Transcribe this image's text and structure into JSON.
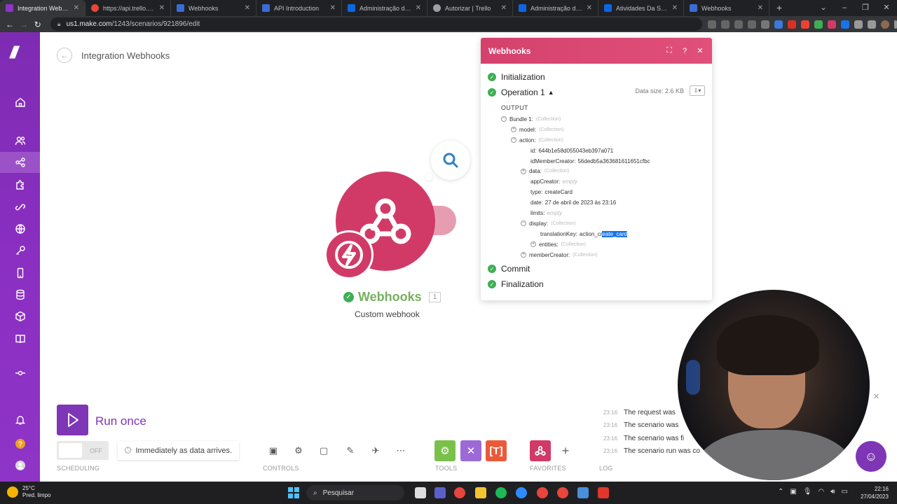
{
  "browser": {
    "tabs": [
      {
        "title": "Integration Webhooks",
        "active": true,
        "color": "#8e34c6"
      },
      {
        "title": "https://api.trello.com/",
        "active": false,
        "color": "#e8453c"
      },
      {
        "title": "Webhooks",
        "active": false,
        "color": "#3b6bd6"
      },
      {
        "title": "API Introduction",
        "active": false,
        "color": "#3b6bd6"
      },
      {
        "title": "Administração de pow",
        "active": false,
        "color": "#0c66e4"
      },
      {
        "title": "Autorizar | Trello",
        "active": false,
        "color": "#9aa0a6"
      },
      {
        "title": "Administração de pow",
        "active": false,
        "color": "#0c66e4"
      },
      {
        "title": "Atividades Da Semana",
        "active": false,
        "color": "#0c66e4"
      },
      {
        "title": "Webhooks",
        "active": false,
        "color": "#3b6bd6"
      }
    ],
    "url_host": "us1.make.com",
    "url_path": "/1243/scenarios/921896/edit"
  },
  "scenario": {
    "title": "Integration Webhooks"
  },
  "module": {
    "name": "Webhooks",
    "count": "1",
    "subtitle": "Custom webhook"
  },
  "panel": {
    "title": "Webhooks",
    "phases": {
      "initialization": "Initialization",
      "operation": "Operation 1",
      "commit": "Commit",
      "finalization": "Finalization"
    },
    "data_size": "Data size: 2.6 KB",
    "output_label": "OUTPUT",
    "collection_tag": "(Collection)",
    "empty_tag": "empty",
    "tree": {
      "bundle": "Bundle 1:",
      "model": "model:",
      "action": "action:",
      "id_key": "id:",
      "id_val": "644b1e58d055043eb397a071",
      "creator_key": "idMemberCreator:",
      "creator_val": "56dedb5a363681611651cfbc",
      "data": "data:",
      "appcreator": "appCreator:",
      "type_key": "type:",
      "type_val": "createCard",
      "date_key": "date:",
      "date_val": "27 de abril de 2023 às 23:16",
      "limits": "limits:",
      "display": "display:",
      "translation_key": "translationKey:",
      "translation_val_a": "action_cr",
      "translation_val_b": "eate_card",
      "entities": "entities:",
      "member_creator": "memberCreator:"
    }
  },
  "toolbar": {
    "run_label": "Run once",
    "toggle_label": "OFF",
    "schedule_label": "Immediately as data arrives.",
    "groups": {
      "scheduling": "SCHEDULING",
      "controls": "CONTROLS",
      "tools": "TOOLS",
      "favorites": "FAVORITES",
      "log": "LOG"
    }
  },
  "log": {
    "entries": [
      {
        "time": "23:16",
        "text": "The request was"
      },
      {
        "time": "23:16",
        "text": "The scenario was"
      },
      {
        "time": "23:16",
        "text": "The scenario was fi"
      },
      {
        "time": "23:16",
        "text": "The scenario run was co"
      }
    ]
  },
  "taskbar": {
    "weather_temp": "25°C",
    "weather_desc": "Pred. limpo",
    "search_label": "Pesquisar",
    "time": "22:16",
    "date": "27/04/2023"
  },
  "colors": {
    "brand_purple": "#7e35b6",
    "webhook_red": "#d13a67",
    "success_green": "#3fae55",
    "highlight_blue": "#1a73e8"
  }
}
